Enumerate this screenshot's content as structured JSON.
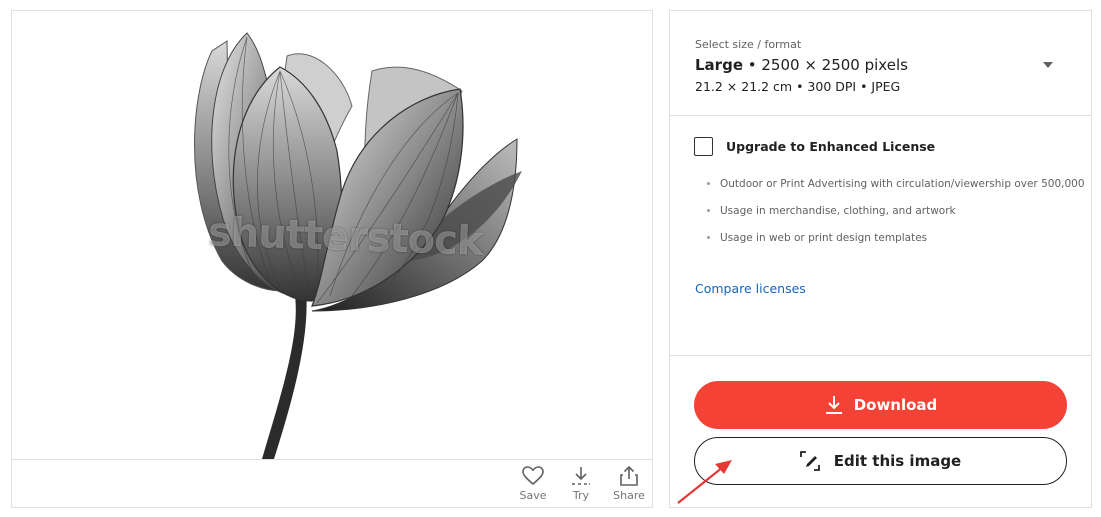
{
  "preview": {
    "watermark": "shutterstock",
    "actions": [
      {
        "icon": "heart-icon",
        "label": "Save"
      },
      {
        "icon": "download-try-icon",
        "label": "Try"
      },
      {
        "icon": "share-icon",
        "label": "Share"
      }
    ]
  },
  "size_select": {
    "caption": "Select size / format",
    "size_name": "Large",
    "separator": " • ",
    "pixels": "2500 × 2500 pixels",
    "details": "21.2 × 21.2 cm • 300 DPI • JPEG"
  },
  "enhanced_license": {
    "checkbox_label": "Upgrade to Enhanced License",
    "checked": false,
    "features": [
      "Outdoor or Print Advertising with circulation/viewership over 500,000",
      "Usage in merchandise, clothing, and artwork",
      "Usage in web or print design templates"
    ],
    "compare_link": "Compare licenses"
  },
  "buttons": {
    "download_label": "Download",
    "edit_label": "Edit this image"
  },
  "colors": {
    "download_bg": "#f44336",
    "link": "#1565c0",
    "annotation_arrow": "#e53935"
  }
}
